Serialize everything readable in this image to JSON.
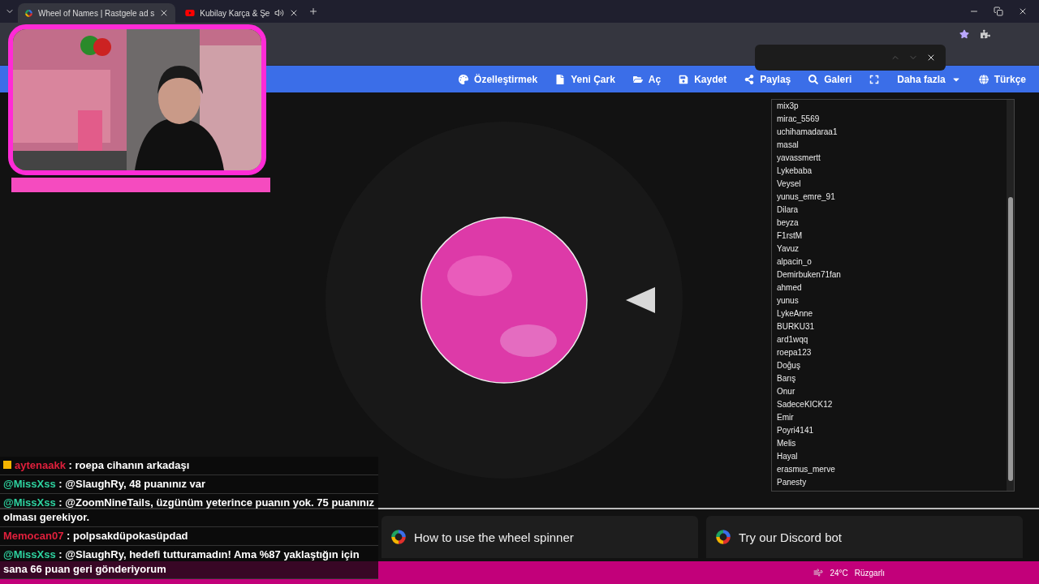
{
  "browser_tabs": [
    {
      "title": "Wheel of Names | Rastgele ad s",
      "kind": "wheel",
      "selected": true
    },
    {
      "title": "Kubilay Karça & Şe",
      "kind": "video",
      "selected": false,
      "audio": true
    }
  ],
  "nav": [
    {
      "label": "Özelleştirmek",
      "kind": "palette"
    },
    {
      "label": "Yeni Çark",
      "kind": "file"
    },
    {
      "label": "Aç",
      "kind": "folder"
    },
    {
      "label": "Kaydet",
      "kind": "save"
    },
    {
      "label": "Paylaş",
      "kind": "share"
    },
    {
      "label": "Galeri",
      "kind": "search"
    },
    {
      "kind": "fullscreen"
    },
    {
      "label": "Daha fazla",
      "kind": "menu"
    },
    {
      "label": "Türkçe",
      "kind": "globe"
    }
  ],
  "entries": [
    "mix3p",
    "mirac_5569",
    "uchihamadaraa1",
    "masal",
    "yavassmertt",
    "Lykebaba",
    "Veysel",
    "yunus_emre_91",
    "Dilara",
    "beyza",
    "F1rstM",
    "Yavuz",
    "alpacin_o",
    "Demirbuken71fan",
    "ahmed",
    "yunus",
    "LykeAnne",
    "BURKU31",
    "ard1wqq",
    "roepa123",
    "Doğuş",
    "Barış",
    "Onur",
    "SadeceKICK12",
    "Emir",
    "Poyri4141",
    "Melis",
    "Hayal",
    "erasmus_merve",
    "Panesty"
  ],
  "cards": [
    {
      "title": "How to use the wheel spinner"
    },
    {
      "title": "Try our Discord bot"
    }
  ],
  "chat": [
    {
      "user": "aytenaakk",
      "color": "#e0203c",
      "text": ": roepa cihanın arkadaşı",
      "badges": true
    },
    {
      "user": "@MissXss",
      "color": "#2ed3a0",
      "text": ": @SlaughRy, 48 puanınız var",
      "badges": false
    },
    {
      "user": "@MissXss",
      "color": "#2ed3a0",
      "text": ": @ZoomNineTails, üzgünüm yeterince puanın yok. 75 puanınız olması gerekiyor.",
      "badges": false
    },
    {
      "user": "Memocan07",
      "color": "#e0203c",
      "text": ": polpsakdüpokasüpdad",
      "badges": false
    },
    {
      "user": "@MissXss",
      "color": "#2ed3a0",
      "text": ": @SlaughRy, hedefi tutturamadın! Ama %87 yaklaştığın için sana 66 puan geri gönderiyorum",
      "badges": false
    }
  ],
  "taskbar": {
    "weather": "24°C",
    "condition": "Rüzgarlı"
  }
}
